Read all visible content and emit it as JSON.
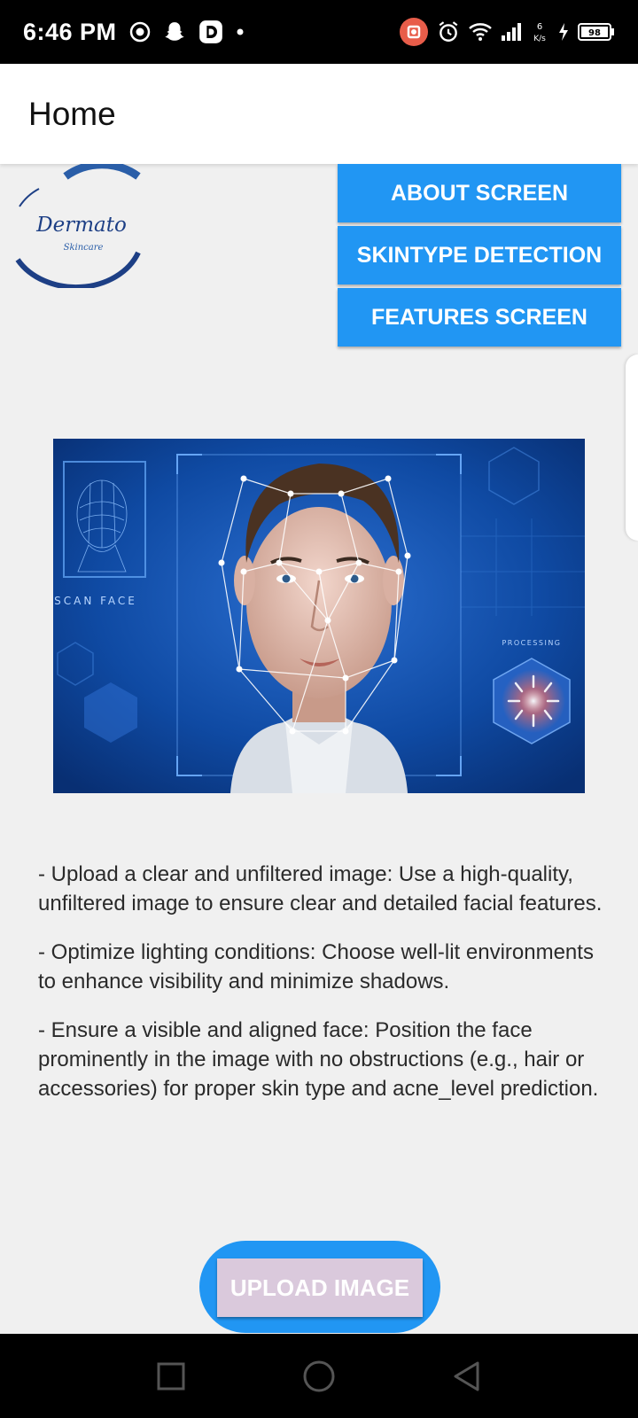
{
  "status_bar": {
    "time": "6:46 PM",
    "left_icons": [
      "screen-record-icon",
      "snapchat-icon",
      "d-app-icon",
      "dot-icon"
    ],
    "right_icons": [
      "record-indicator-icon",
      "alarm-icon",
      "wifi-icon",
      "signal-icon",
      "data-speed-icon",
      "charging-icon",
      "battery-icon"
    ],
    "data_speed": "6\nK/s",
    "battery_level": "98"
  },
  "app_bar": {
    "title": "Home"
  },
  "logo": {
    "text": "Dermato",
    "tagline": "Skincare"
  },
  "nav": {
    "buttons": [
      "ABOUT SCREEN",
      "SKINTYPE DETECTION",
      "FEATURES SCREEN"
    ]
  },
  "hero_image": {
    "scan_label": "SCAN FACE",
    "processing_label": "PROCESSING"
  },
  "tips": [
    "- Upload a clear and unfiltered image: Use a high-quality, unfiltered image to ensure clear and detailed facial features.",
    "- Optimize lighting conditions: Choose well-lit environments to enhance visibility and minimize shadows.",
    "- Ensure a visible and aligned face: Position the face prominently in the image with no obstructions (e.g., hair or accessories) for proper skin type and acne_level prediction."
  ],
  "upload": {
    "label": "UPLOAD IMAGE"
  },
  "nav_bar": {
    "buttons": [
      "recents-square-icon",
      "home-circle-icon",
      "back-triangle-icon"
    ]
  },
  "colors": {
    "primary": "#2196f3",
    "upload_button": "#dac9dc",
    "background": "#f0f0f0",
    "hero_bg": "#0d3f8f"
  }
}
